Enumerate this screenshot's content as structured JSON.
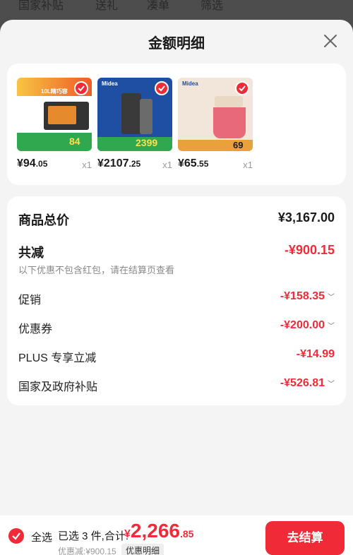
{
  "background_nav": {
    "tabs": [
      "国家补贴",
      "送礼",
      "凑单",
      "筛选"
    ]
  },
  "sheet": {
    "title": "金额明细"
  },
  "products": [
    {
      "price_int": "¥94",
      "price_dec": ".05",
      "qty": "x1",
      "badge_text": "10L精巧容",
      "sub_text": "84"
    },
    {
      "price_int": "¥2107",
      "price_dec": ".25",
      "qty": "x1",
      "badge_text": "Midea",
      "sub_text": "2399"
    },
    {
      "price_int": "¥65",
      "price_dec": ".55",
      "qty": "x1",
      "badge_text": "Midea",
      "sub_text": "69"
    }
  ],
  "summary": {
    "total_label": "商品总价",
    "total_value": "¥3,167.00",
    "reduce_label": "共减",
    "reduce_value": "-¥900.15",
    "reduce_note": "以下优惠不包含红包，请在结算页查看",
    "items": [
      {
        "label": "促销",
        "value": "-¥158.35",
        "has_chevron": true
      },
      {
        "label": "优惠券",
        "value": "-¥200.00",
        "has_chevron": true
      },
      {
        "label": "PLUS 专享立减",
        "value": "-¥14.99",
        "has_chevron": false
      },
      {
        "label": "国家及政府补贴",
        "value": "-¥526.81",
        "has_chevron": true
      }
    ]
  },
  "bottom_bar": {
    "select_all": "全选",
    "selected_prefix": "已选 3 件,合计:",
    "total_currency": "¥",
    "total_int": "2,266",
    "total_dec": ".85",
    "discount_line": "优惠减:¥900.15",
    "detail_tag": "优惠明细",
    "checkout": "去结算"
  },
  "colors": {
    "accent": "#f02b37",
    "sheet_bg": "#f4f4f4"
  }
}
